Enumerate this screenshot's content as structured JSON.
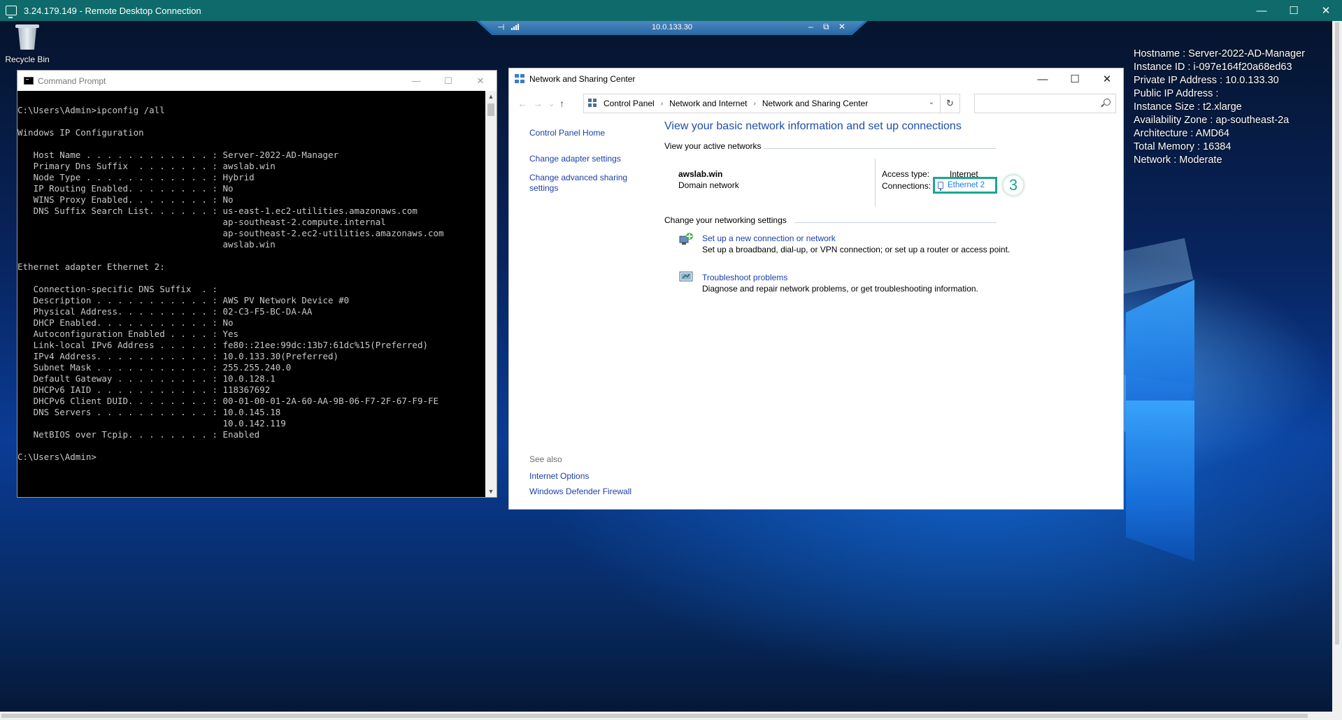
{
  "rdp": {
    "title": "3.24.179.149 - Remote Desktop Connection",
    "minimize": "—",
    "maximize": "☐",
    "close": "✕"
  },
  "connection_bar": {
    "ip": "10.0.133.30",
    "pin": "⊣",
    "minimize": "–",
    "restore": "⧉",
    "close": "✕"
  },
  "desktop": {
    "recycle_bin_label": "Recycle Bin"
  },
  "sysinfo": {
    "lines": [
      "Hostname : Server-2022-AD-Manager",
      "Instance ID : i-097e164f20a68ed63",
      "Private IP Address : 10.0.133.30",
      "Public IP Address :",
      "Instance Size : t2.xlarge",
      "Availability Zone : ap-southeast-2a",
      "Architecture : AMD64",
      "Total Memory : 16384",
      "Network : Moderate"
    ]
  },
  "cmd": {
    "title": "Command Prompt",
    "minimize": "—",
    "maximize": "☐",
    "close": "✕",
    "output": "C:\\Users\\Admin>ipconfig /all\n\nWindows IP Configuration\n\n   Host Name . . . . . . . . . . . . : Server-2022-AD-Manager\n   Primary Dns Suffix  . . . . . . . : awslab.win\n   Node Type . . . . . . . . . . . . : Hybrid\n   IP Routing Enabled. . . . . . . . : No\n   WINS Proxy Enabled. . . . . . . . : No\n   DNS Suffix Search List. . . . . . : us-east-1.ec2-utilities.amazonaws.com\n                                       ap-southeast-2.compute.internal\n                                       ap-southeast-2.ec2-utilities.amazonaws.com\n                                       awslab.win\n\nEthernet adapter Ethernet 2:\n\n   Connection-specific DNS Suffix  . :\n   Description . . . . . . . . . . . : AWS PV Network Device #0\n   Physical Address. . . . . . . . . : 02-C3-F5-BC-DA-AA\n   DHCP Enabled. . . . . . . . . . . : No\n   Autoconfiguration Enabled . . . . : Yes\n   Link-local IPv6 Address . . . . . : fe80::21ee:99dc:13b7:61dc%15(Preferred)\n   IPv4 Address. . . . . . . . . . . : 10.0.133.30(Preferred)\n   Subnet Mask . . . . . . . . . . . : 255.255.240.0\n   Default Gateway . . . . . . . . . : 10.0.128.1\n   DHCPv6 IAID . . . . . . . . . . . : 118367692\n   DHCPv6 Client DUID. . . . . . . . : 00-01-00-01-2A-60-AA-9B-06-F7-2F-67-F9-FE\n   DNS Servers . . . . . . . . . . . : 10.0.145.18\n                                       10.0.142.119\n   NetBIOS over Tcpip. . . . . . . . : Enabled\n\nC:\\Users\\Admin>"
  },
  "nsc": {
    "title": "Network and Sharing Center",
    "minimize": "—",
    "maximize": "☐",
    "close": "✕",
    "nav_back": "←",
    "nav_forward": "→",
    "nav_recent": "⌄",
    "nav_up": "↑",
    "breadcrumb": [
      "Control Panel",
      "Network and Internet",
      "Network and Sharing Center"
    ],
    "refresh": "↻",
    "search_placeholder": "",
    "left_nav": [
      "Control Panel Home",
      "Change adapter settings",
      "Change advanced sharing settings"
    ],
    "see_also_header": "See also",
    "see_also": [
      "Internet Options",
      "Windows Defender Firewall"
    ],
    "heading": "View your basic network information and set up connections",
    "active_networks_header": "View your active networks",
    "network_name": "awslab.win",
    "network_type": "Domain network",
    "access_type_label": "Access type:",
    "access_type_value": "Internet",
    "connections_label": "Connections:",
    "connection_link": "Ethernet 2",
    "step_badge": "3",
    "change_settings_header": "Change your networking settings",
    "tasks": [
      {
        "link": "Set up a new connection or network",
        "desc": "Set up a broadband, dial-up, or VPN connection; or set up a router or access point."
      },
      {
        "link": "Troubleshoot problems",
        "desc": "Diagnose and repair network problems, or get troubleshooting information."
      }
    ]
  }
}
